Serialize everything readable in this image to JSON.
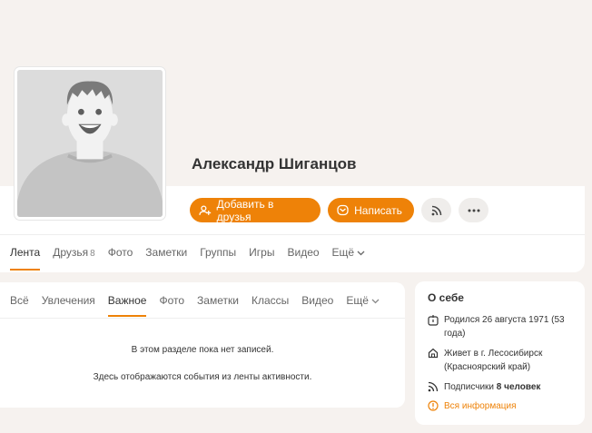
{
  "profile": {
    "name": "Александр Шиганцов",
    "avatar_icon": "default-avatar-icon"
  },
  "actions": {
    "add_friend": "Добавить в друзья",
    "write": "Написать",
    "subscribe_icon": "rss-icon",
    "more_icon": "more-dots-icon"
  },
  "main_nav": [
    {
      "label": "Лента",
      "active": true
    },
    {
      "label": "Друзья",
      "count": "8"
    },
    {
      "label": "Фото"
    },
    {
      "label": "Заметки"
    },
    {
      "label": "Группы"
    },
    {
      "label": "Игры"
    },
    {
      "label": "Видео"
    },
    {
      "label": "Ещё"
    }
  ],
  "feed": {
    "tabs": [
      {
        "label": "Всё"
      },
      {
        "label": "Увлечения"
      },
      {
        "label": "Важное",
        "active": true
      },
      {
        "label": "Фото"
      },
      {
        "label": "Заметки"
      },
      {
        "label": "Классы"
      },
      {
        "label": "Видео"
      },
      {
        "label": "Ещё"
      }
    ],
    "empty_line1": "В этом разделе пока нет записей.",
    "empty_line2": "Здесь отображаются события из ленты активности."
  },
  "about": {
    "title": "О себе",
    "born": "Родился 26 августа 1971 (53 года)",
    "lives": "Живет в г. Лесосибирск (Красноярский край)",
    "followers_prefix": "Подписчики ",
    "followers_count": "8 человек",
    "all_info": "Вся информация"
  },
  "colors": {
    "accent": "#ee8208",
    "background": "#f6f2ef"
  }
}
